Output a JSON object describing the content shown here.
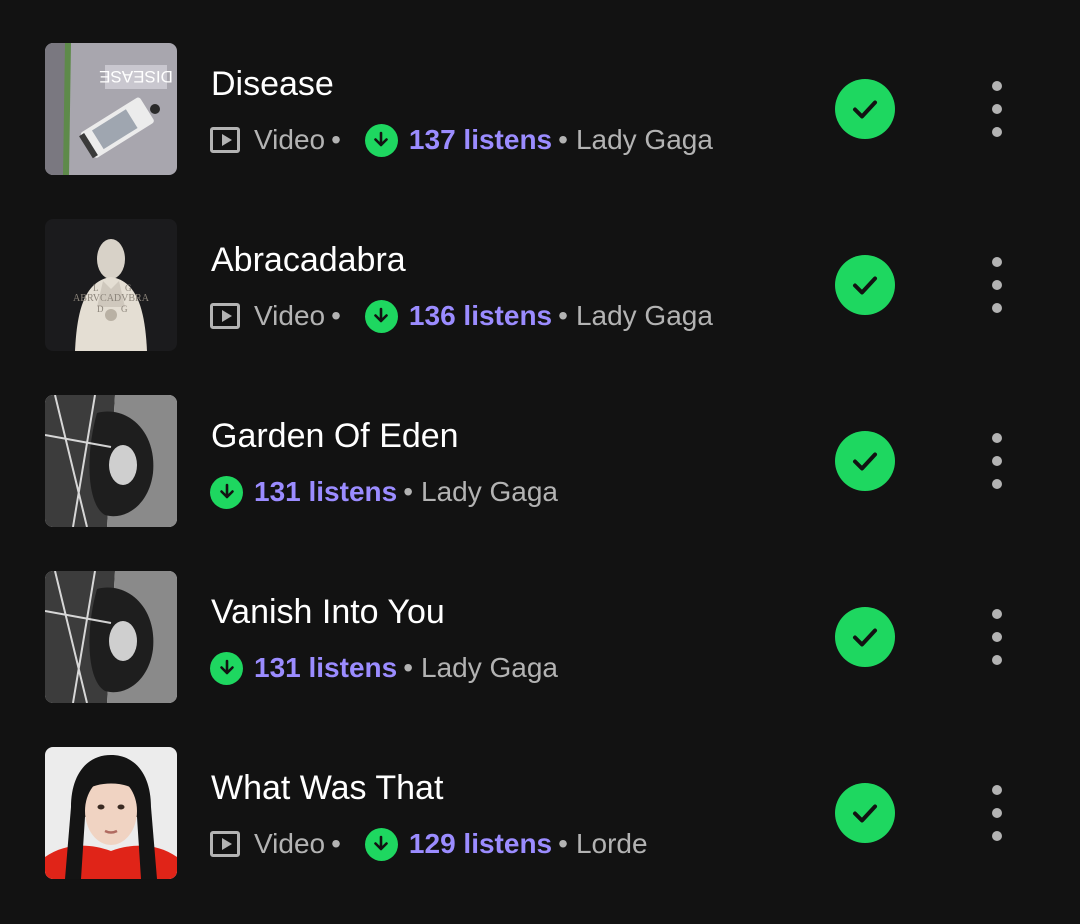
{
  "tracks": [
    {
      "title": "Disease",
      "has_video": true,
      "video_label": "Video",
      "listens": "137 listens",
      "artist": "Lady Gaga",
      "cover_icon": "album-cover-disease"
    },
    {
      "title": "Abracadabra",
      "has_video": true,
      "video_label": "Video",
      "listens": "136 listens",
      "artist": "Lady Gaga",
      "cover_icon": "album-cover-abracadabra"
    },
    {
      "title": "Garden Of Eden",
      "has_video": false,
      "listens": "131 listens",
      "artist": "Lady Gaga",
      "cover_icon": "album-cover-mayhem"
    },
    {
      "title": "Vanish Into You",
      "has_video": false,
      "listens": "131 listens",
      "artist": "Lady Gaga",
      "cover_icon": "album-cover-mayhem"
    },
    {
      "title": "What Was That",
      "has_video": true,
      "video_label": "Video",
      "listens": "129 listens",
      "artist": "Lorde",
      "cover_icon": "album-cover-what-was-that"
    }
  ],
  "separator": "•",
  "icons": {
    "video": "video-icon",
    "download": "download-icon",
    "added": "checkmark-icon",
    "more": "more-options-icon"
  },
  "colors": {
    "background": "#121212",
    "accent_green": "#1ed760",
    "listens_purple": "#9b8cff",
    "secondary_text": "#b3b3b3"
  }
}
